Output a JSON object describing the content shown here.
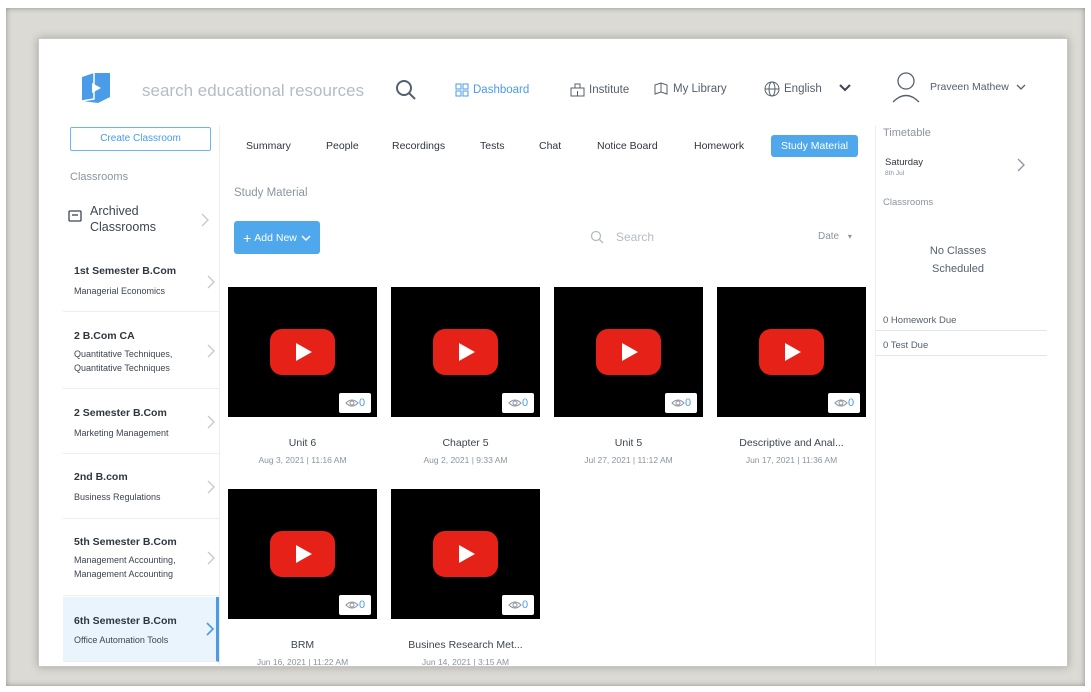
{
  "header": {
    "search_placeholder": "search educational resources",
    "nav": [
      {
        "label": "Dashboard",
        "icon": "dashboard-icon"
      },
      {
        "label": "Institute",
        "icon": "institute-icon"
      },
      {
        "label": "My Library",
        "icon": "library-icon"
      },
      {
        "label": "English",
        "icon": "globe-icon"
      }
    ],
    "user_name": "Praveen Mathew",
    "accent": "#4a9be8"
  },
  "sidebar": {
    "create_label": "Create Classroom",
    "classrooms_label": "Classrooms",
    "archived_label_1": "Archived",
    "archived_label_2": "Classrooms",
    "items": [
      {
        "name": "1st Semester B.Com",
        "sub1": "Managerial Economics",
        "sub2": ""
      },
      {
        "name": "2 B.Com CA",
        "sub1": "Quantitative Techniques,",
        "sub2": "Quantitative Techniques"
      },
      {
        "name": "2 Semester B.Com",
        "sub1": "Marketing Management",
        "sub2": ""
      },
      {
        "name": "2nd B.com",
        "sub1": "Business Regulations",
        "sub2": ""
      },
      {
        "name": "5th Semester B.Com",
        "sub1": "Management Accounting,",
        "sub2": "Management Accounting"
      },
      {
        "name": "6th Semester B.Com",
        "sub1": "Office Automation Tools",
        "sub2": ""
      }
    ]
  },
  "tabs": [
    "Summary",
    "People",
    "Recordings",
    "Tests",
    "Chat",
    "Notice Board",
    "Homework",
    "Study Material"
  ],
  "main": {
    "section_title": "Study Material",
    "add_new_label": "Add New",
    "search_placeholder": "Search",
    "sort_label": "Date"
  },
  "materials": [
    {
      "title": "Unit 6",
      "date": "Aug 3, 2021 | 11:16 AM",
      "views": "0"
    },
    {
      "title": "Chapter 5",
      "date": "Aug 2, 2021 | 9:33 AM",
      "views": "0"
    },
    {
      "title": "Unit 5",
      "date": "Jul 27, 2021 | 11:12 AM",
      "views": "0"
    },
    {
      "title": "Descriptive and Anal...",
      "date": "Jun 17, 2021 | 11:36 AM",
      "views": "0"
    },
    {
      "title": "BRM",
      "date": "Jun 16, 2021 | 11:22 AM",
      "views": "0"
    },
    {
      "title": "Busines Research Met...",
      "date": "Jun 14, 2021 | 3:15 AM",
      "views": "0"
    }
  ],
  "right_panel": {
    "timetable_label": "Timetable",
    "day": "Saturday",
    "day_date": "8th Jul",
    "classrooms_label": "Classrooms",
    "no_classes_1": "No Classes",
    "no_classes_2": "Scheduled",
    "homework_due": "0 Homework Due",
    "test_due": "0 Test Due"
  }
}
